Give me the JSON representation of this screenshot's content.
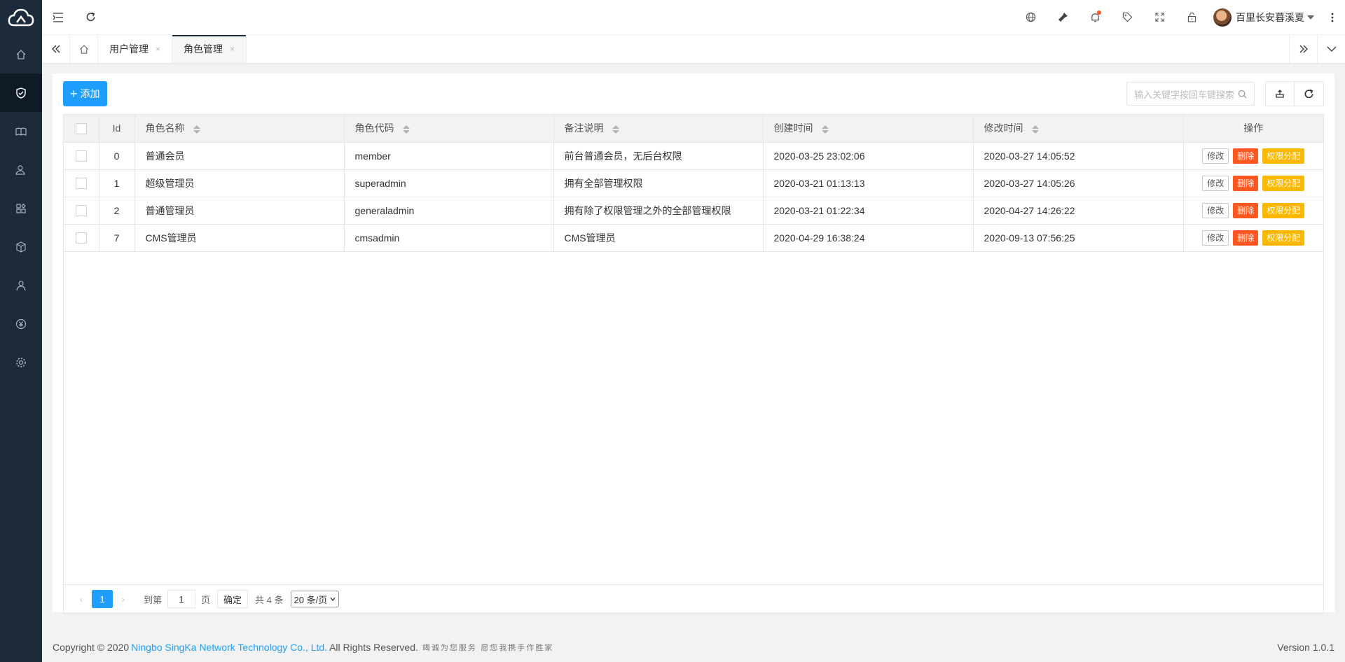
{
  "user": {
    "name": "百里长安暮溪夏"
  },
  "tabs": [
    {
      "label": "用户管理",
      "close": "×"
    },
    {
      "label": "角色管理",
      "close": "×"
    }
  ],
  "toolbar": {
    "add_label": "添加",
    "search_placeholder": "输入关键字按回车键搜索"
  },
  "table": {
    "columns": [
      "Id",
      "角色名称",
      "角色代码",
      "备注说明",
      "创建时间",
      "修改时间",
      "操作"
    ],
    "rows": [
      {
        "id": "0",
        "name": "普通会员",
        "code": "member",
        "remark": "前台普通会员，无后台权限",
        "created": "2020-03-25 23:02:06",
        "modified": "2020-03-27 14:05:52"
      },
      {
        "id": "1",
        "name": "超级管理员",
        "code": "superadmin",
        "remark": "拥有全部管理权限",
        "created": "2020-03-21 01:13:13",
        "modified": "2020-03-27 14:05:26"
      },
      {
        "id": "2",
        "name": "普通管理员",
        "code": "generaladmin",
        "remark": "拥有除了权限管理之外的全部管理权限",
        "created": "2020-03-21 01:22:34",
        "modified": "2020-04-27 14:26:22"
      },
      {
        "id": "7",
        "name": "CMS管理员",
        "code": "cmsadmin",
        "remark": "CMS管理员",
        "created": "2020-04-29 16:38:24",
        "modified": "2020-09-13 07:56:25"
      }
    ],
    "actions": {
      "edit": "修改",
      "delete": "删除",
      "perm": "权限分配"
    }
  },
  "pager": {
    "current": "1",
    "goto_label": "到第",
    "page_input": "1",
    "page_unit": "页",
    "confirm": "确定",
    "total": "共 4 条",
    "page_size": "20 条/页"
  },
  "footer": {
    "copyright": "Copyright © 2020",
    "company": "Ningbo SingKa Network Technology Co., Ltd.",
    "rights": "All Rights Reserved.",
    "slogan": "竭诚为您服务 愿您我携手作胜家",
    "version": "Version 1.0.1"
  },
  "colors": {
    "sidebar": "#1c2a3a",
    "primary": "#1e9fff",
    "danger": "#ff5722",
    "warning": "#ffb800"
  }
}
